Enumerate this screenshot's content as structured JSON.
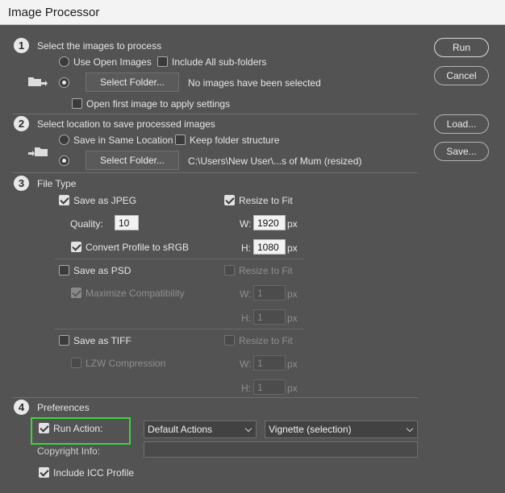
{
  "window": {
    "title": "Image Processor"
  },
  "section1": {
    "number": "1",
    "title": "Select the images to process",
    "use_open_images": "Use Open Images",
    "include_subfolders": "Include All sub-folders",
    "select_folder": "Select Folder...",
    "status": "No images have been selected",
    "open_first": "Open first image to apply settings"
  },
  "section2": {
    "number": "2",
    "title": "Select location to save processed images",
    "save_same": "Save in Same Location",
    "keep_structure": "Keep folder structure",
    "select_folder": "Select Folder...",
    "path": "C:\\Users\\New User\\...s of Mum (resized)"
  },
  "section3": {
    "number": "3",
    "title": "File Type",
    "jpeg": {
      "label": "Save as JPEG",
      "resize": "Resize to Fit",
      "quality_label": "Quality:",
      "quality": "10",
      "convert": "Convert Profile to sRGB",
      "w_label": "W:",
      "w": "1920",
      "w_unit": "px",
      "h_label": "H:",
      "h": "1080",
      "h_unit": "px"
    },
    "psd": {
      "label": "Save as PSD",
      "resize": "Resize to Fit",
      "maximize": "Maximize Compatibility",
      "w_label": "W:",
      "w": "1",
      "w_unit": "px",
      "h_label": "H:",
      "h": "1",
      "h_unit": "px"
    },
    "tiff": {
      "label": "Save as TIFF",
      "resize": "Resize to Fit",
      "lzw": "LZW Compression",
      "w_label": "W:",
      "w": "1",
      "w_unit": "px",
      "h_label": "H:",
      "h": "1",
      "h_unit": "px"
    }
  },
  "section4": {
    "number": "4",
    "title": "Preferences",
    "run_action": "Run Action:",
    "action_set": "Default Actions",
    "action": "Vignette (selection)",
    "copyright_label": "Copyright Info:",
    "copyright": "",
    "icc": "Include ICC Profile"
  },
  "buttons": {
    "run": "Run",
    "cancel": "Cancel",
    "load": "Load...",
    "save": "Save..."
  },
  "colors": {
    "highlight": "#3fd33f",
    "background": "#535353"
  }
}
